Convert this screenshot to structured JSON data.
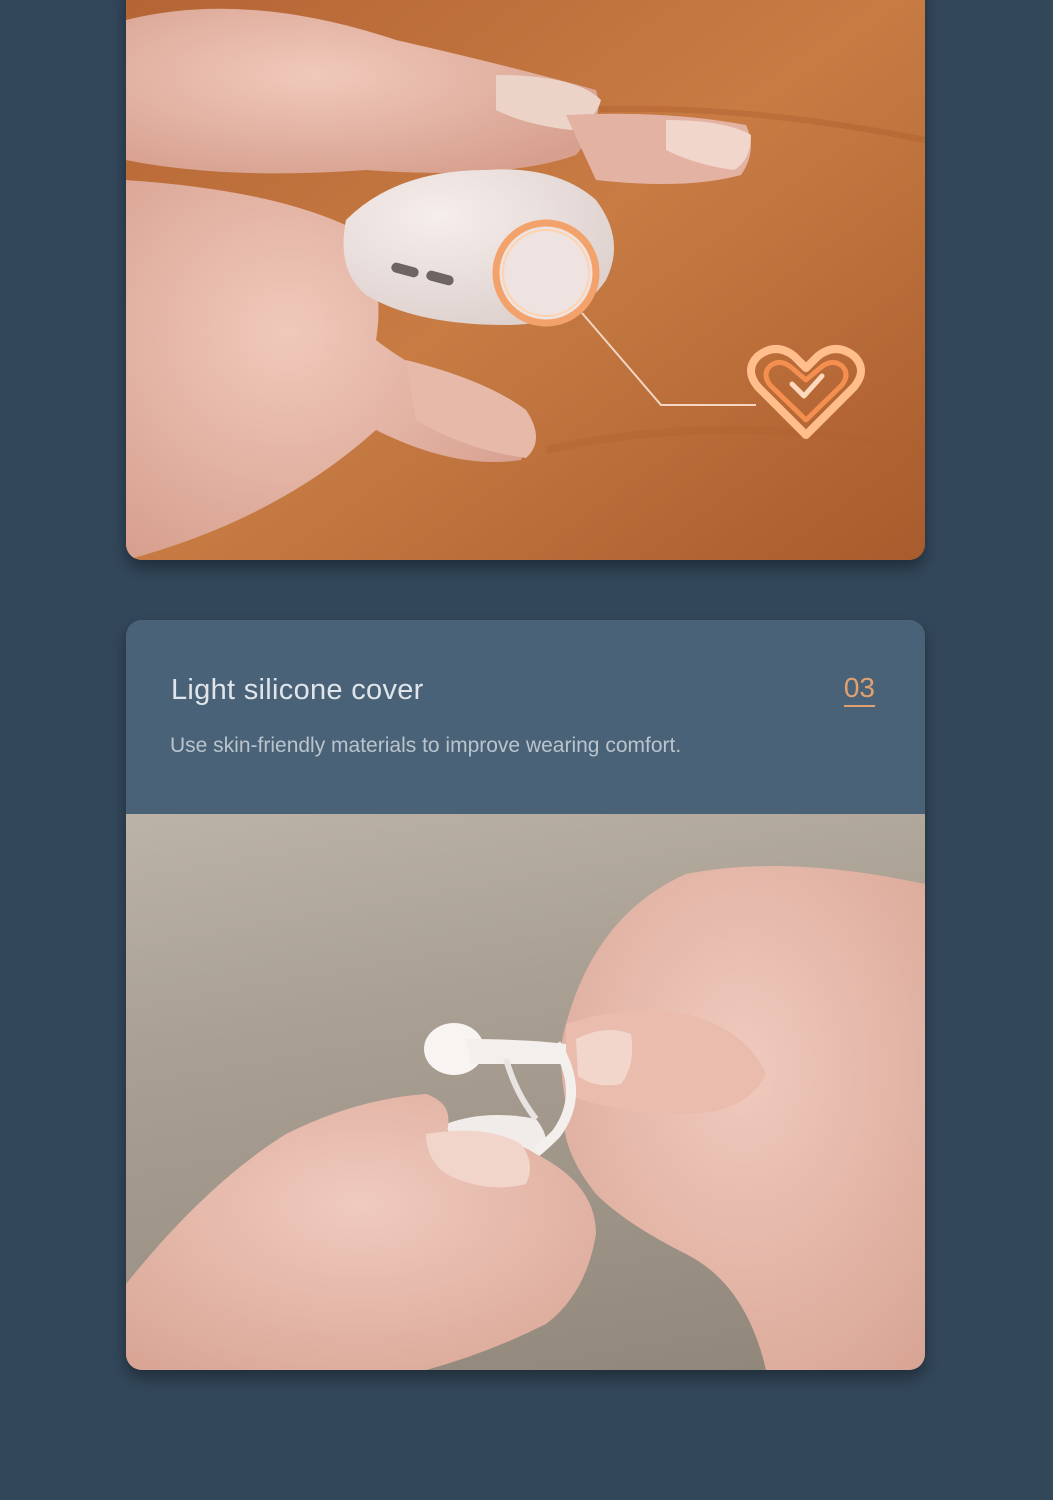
{
  "feature": {
    "title": "Light silicone cover",
    "number": "03",
    "description": "Use skin-friendly materials to improve wearing comfort."
  },
  "images": {
    "top": "hand holding white earbud with touch area highlighted and heart icon",
    "bottom": "hands bending white silicone ear hook"
  },
  "colors": {
    "background": "#32475a",
    "card_header": "#4a6277",
    "accent": "#e3a06f"
  },
  "icons": [
    "heart-check-icon",
    "touch-ring-icon"
  ]
}
